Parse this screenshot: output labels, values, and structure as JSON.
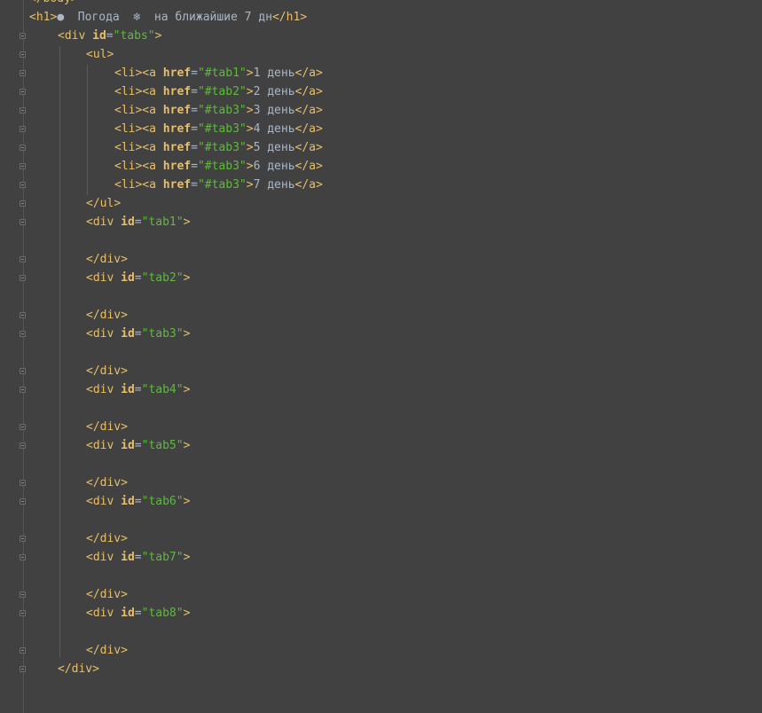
{
  "editor": {
    "lines": [
      {
        "type": "close",
        "tag": "body",
        "indent": 0
      },
      {
        "type": "h1",
        "bullet": "●",
        "text1": "  Погода  ",
        "snow": "❄",
        "text2": "  на ближайшие 7 дн",
        "indent": 0
      },
      {
        "type": "open_attr",
        "tag": "div",
        "attr": "id",
        "value": "\"tabs\"",
        "indent": 1
      },
      {
        "type": "open",
        "tag": "ul",
        "indent": 2
      },
      {
        "type": "li",
        "attr": "href",
        "value": "\"#tab1\"",
        "text": "1 день",
        "indent": 3
      },
      {
        "type": "li",
        "attr": "href",
        "value": "\"#tab2\"",
        "text": "2 день",
        "indent": 3
      },
      {
        "type": "li",
        "attr": "href",
        "value": "\"#tab3\"",
        "text": "3 день",
        "indent": 3
      },
      {
        "type": "li",
        "attr": "href",
        "value": "\"#tab3\"",
        "text": "4 день",
        "indent": 3
      },
      {
        "type": "li",
        "attr": "href",
        "value": "\"#tab3\"",
        "text": "5 день",
        "indent": 3
      },
      {
        "type": "li",
        "attr": "href",
        "value": "\"#tab3\"",
        "text": "6 день",
        "indent": 3
      },
      {
        "type": "li",
        "attr": "href",
        "value": "\"#tab3\"",
        "text": "7 день",
        "indent": 3
      },
      {
        "type": "close",
        "tag": "ul",
        "indent": 2
      },
      {
        "type": "open_attr",
        "tag": "div",
        "attr": "id",
        "value": "\"tab1\"",
        "indent": 2
      },
      {
        "type": "blank"
      },
      {
        "type": "close",
        "tag": "div",
        "indent": 2
      },
      {
        "type": "open_attr",
        "tag": "div",
        "attr": "id",
        "value": "\"tab2\"",
        "indent": 2
      },
      {
        "type": "blank"
      },
      {
        "type": "close",
        "tag": "div",
        "indent": 2
      },
      {
        "type": "open_attr",
        "tag": "div",
        "attr": "id",
        "value": "\"tab3\"",
        "indent": 2
      },
      {
        "type": "blank"
      },
      {
        "type": "close",
        "tag": "div",
        "indent": 2
      },
      {
        "type": "open_attr",
        "tag": "div",
        "attr": "id",
        "value": "\"tab4\"",
        "indent": 2
      },
      {
        "type": "blank"
      },
      {
        "type": "close",
        "tag": "div",
        "indent": 2
      },
      {
        "type": "open_attr",
        "tag": "div",
        "attr": "id",
        "value": "\"tab5\"",
        "indent": 2
      },
      {
        "type": "blank"
      },
      {
        "type": "close",
        "tag": "div",
        "indent": 2
      },
      {
        "type": "open_attr",
        "tag": "div",
        "attr": "id",
        "value": "\"tab6\"",
        "indent": 2
      },
      {
        "type": "blank"
      },
      {
        "type": "close",
        "tag": "div",
        "indent": 2
      },
      {
        "type": "open_attr",
        "tag": "div",
        "attr": "id",
        "value": "\"tab7\"",
        "indent": 2
      },
      {
        "type": "blank"
      },
      {
        "type": "close",
        "tag": "div",
        "indent": 2
      },
      {
        "type": "open_attr",
        "tag": "div",
        "attr": "id",
        "value": "\"tab8\"",
        "indent": 2
      },
      {
        "type": "blank"
      },
      {
        "type": "close",
        "tag": "div",
        "indent": 2
      },
      {
        "type": "close",
        "tag": "div",
        "indent": 1
      }
    ],
    "colors": {
      "background": "#414141",
      "tag": "#e8bf6a",
      "attribute": "#bababa",
      "string": "#5fb93e",
      "text": "#a9b7c6"
    }
  }
}
